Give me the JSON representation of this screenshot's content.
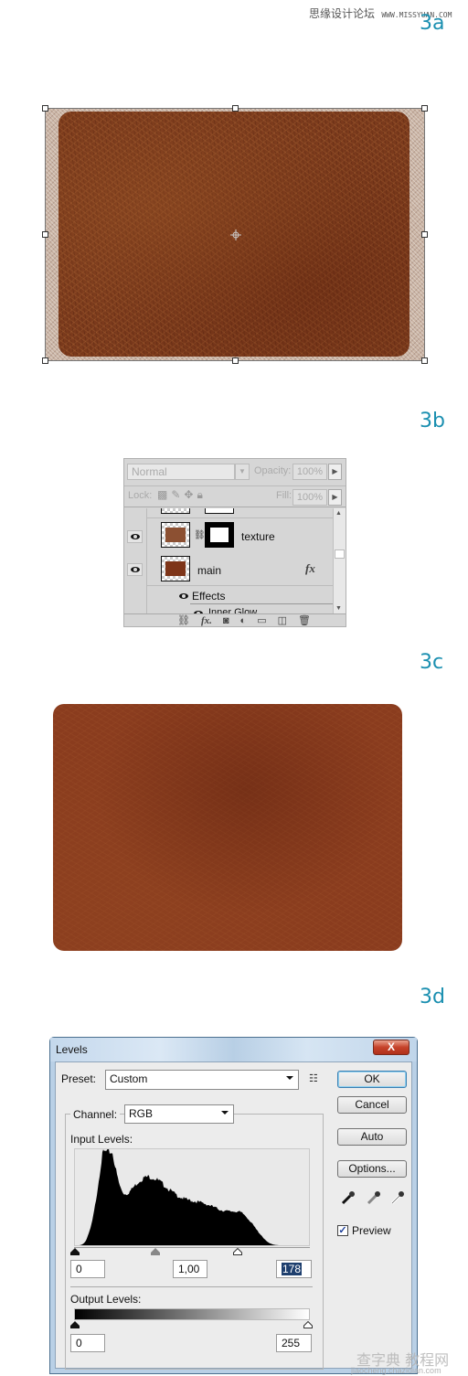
{
  "watermark_top": {
    "site_name": "思缘设计论坛",
    "url": "WWW.MISSYUAN.COM"
  },
  "watermark_bottom": {
    "site_name": "查字典 教程网",
    "url": "jiaocheng.chazidian.com"
  },
  "steps": {
    "a": "3a",
    "b": "3b",
    "c": "3c",
    "d": "3d"
  },
  "layers_panel": {
    "blend_mode": "Normal",
    "opacity_label": "Opacity:",
    "opacity_value": "100%",
    "lock_label": "Lock:",
    "fill_label": "Fill:",
    "fill_value": "100%",
    "layers": [
      {
        "name": "texture",
        "has_mask": true,
        "visible": true
      },
      {
        "name": "main",
        "has_fx": true,
        "visible": true
      }
    ],
    "effects_label": "Effects",
    "partial_effect": "Inner Glow",
    "fx_badge": "fx",
    "footer_icons": [
      "link-icon",
      "fx-icon",
      "mask-icon",
      "adjustment-icon",
      "folder-icon",
      "new-layer-icon",
      "trash-icon"
    ]
  },
  "levels_dialog": {
    "title": "Levels",
    "close_label": "X",
    "preset_label": "Preset:",
    "preset_value": "Custom",
    "channel_label": "Channel:",
    "channel_value": "RGB",
    "input_levels_label": "Input Levels:",
    "input_black": "0",
    "input_gamma": "1,00",
    "input_white": "178",
    "output_levels_label": "Output Levels:",
    "output_black": "0",
    "output_white": "255",
    "buttons": {
      "ok": "OK",
      "cancel": "Cancel",
      "auto": "Auto",
      "options": "Options..."
    },
    "preview_label": "Preview",
    "preview_checked": true,
    "histogram": {
      "description": "luminance histogram, peak near level 30, long tail to ~225",
      "slider_positions": {
        "black": 0,
        "gamma_level": 89,
        "white": 178
      }
    }
  }
}
